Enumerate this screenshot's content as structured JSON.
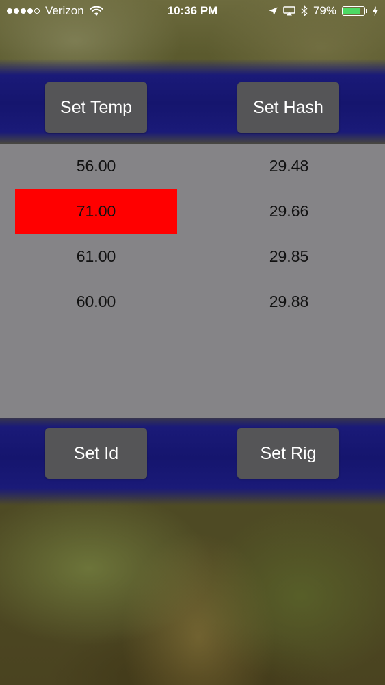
{
  "status_bar": {
    "carrier": "Verizon",
    "signal_dots_filled": 4,
    "signal_dots_total": 5,
    "time": "10:36 PM",
    "battery_percent_label": "79%",
    "battery_level": 0.79,
    "icons": [
      "wifi-icon",
      "location-arrow-icon",
      "airplay-icon",
      "bluetooth-icon",
      "battery-icon",
      "charging-bolt-icon"
    ]
  },
  "top_buttons": {
    "set_temp": "Set Temp",
    "set_hash": "Set Hash"
  },
  "bottom_buttons": {
    "set_id": "Set Id",
    "set_rig": "Set Rig"
  },
  "readings": {
    "temps": [
      "56.00",
      "71.00",
      "61.00",
      "60.00"
    ],
    "hashes": [
      "29.48",
      "29.66",
      "29.85",
      "29.88"
    ],
    "highlighted_temp_index": 1
  },
  "colors": {
    "highlight": "#ff0000",
    "button": "#555557",
    "panel": "#858487",
    "band": "#15156e",
    "battery_fill": "#4cd964"
  }
}
